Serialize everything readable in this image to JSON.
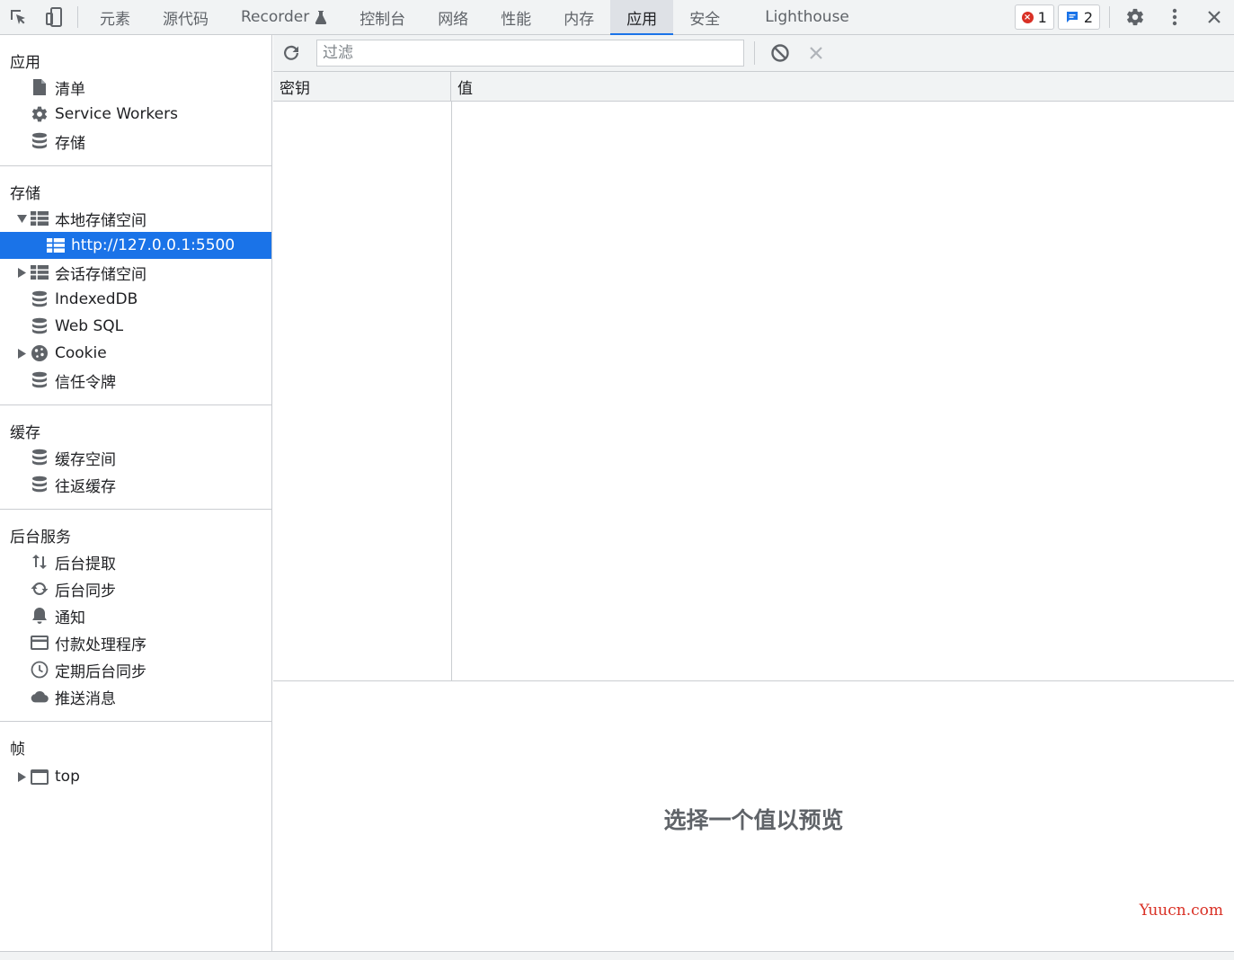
{
  "tabs": [
    "元素",
    "源代码",
    "Recorder",
    "控制台",
    "网络",
    "性能",
    "内存",
    "应用",
    "安全",
    "Lighthouse"
  ],
  "active_tab": "应用",
  "badges": {
    "errors": "1",
    "messages": "2"
  },
  "sidebar": {
    "app": {
      "title": "应用",
      "items": [
        "清单",
        "Service Workers",
        "存储"
      ]
    },
    "storage": {
      "title": "存储",
      "local_storage": "本地存储空间",
      "local_origin": "http://127.0.0.1:5500",
      "session_storage": "会话存储空间",
      "indexeddb": "IndexedDB",
      "websql": "Web SQL",
      "cookie": "Cookie",
      "trust_tokens": "信任令牌"
    },
    "cache": {
      "title": "缓存",
      "items": [
        "缓存空间",
        "往返缓存"
      ]
    },
    "background": {
      "title": "后台服务",
      "items": [
        "后台提取",
        "后台同步",
        "通知",
        "付款处理程序",
        "定期后台同步",
        "推送消息"
      ]
    },
    "frames": {
      "title": "帧",
      "top": "top"
    }
  },
  "toolbar": {
    "filter_placeholder": "过滤"
  },
  "table": {
    "key_header": "密钥",
    "value_header": "值"
  },
  "preview": {
    "empty_text": "选择一个值以预览"
  },
  "watermark": "Yuucn.com",
  "colors": {
    "accent": "#1a73e8",
    "error": "#d93025",
    "icon": "#5f6368"
  }
}
